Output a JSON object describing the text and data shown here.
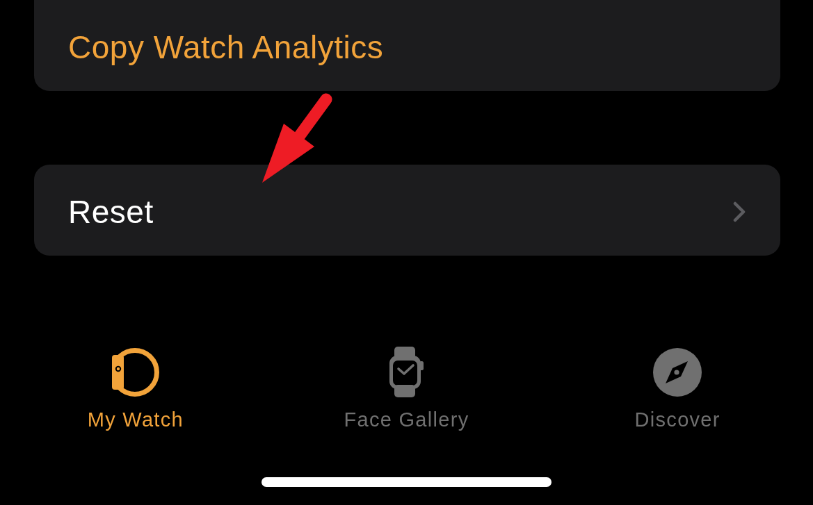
{
  "settings_groups": [
    {
      "rows": [
        {
          "label": "Copy Watch Analytics",
          "kind": "action"
        }
      ]
    },
    {
      "rows": [
        {
          "label": "Reset",
          "kind": "navigation"
        }
      ]
    }
  ],
  "tab_bar": {
    "tabs": [
      {
        "label": "My Watch",
        "selected": true
      },
      {
        "label": "Face Gallery",
        "selected": false
      },
      {
        "label": "Discover",
        "selected": false
      }
    ]
  }
}
